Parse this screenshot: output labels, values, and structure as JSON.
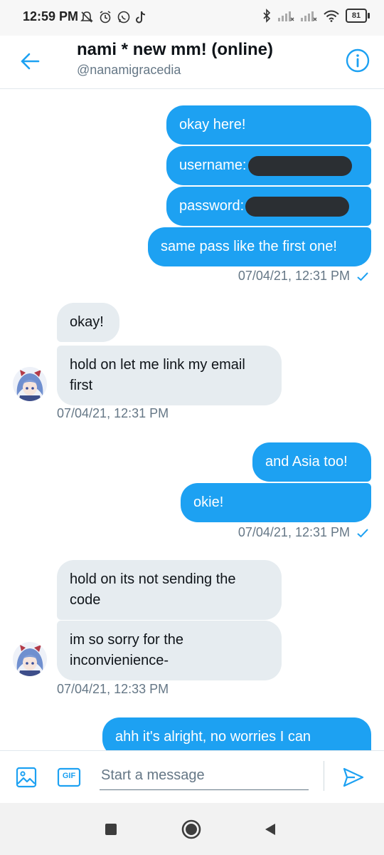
{
  "status_bar": {
    "time": "12:59 PM",
    "battery": "81"
  },
  "header": {
    "title": "nami * new mm! (online)",
    "handle": "@nanamigracedia"
  },
  "messages": {
    "m1": "okay here!",
    "m2_label": "username:",
    "m3_label": "password:",
    "m4": "same pass like the first one!",
    "t1": "07/04/21, 12:31 PM",
    "m5": "okay!",
    "m6_line1": "hold on let me link my email",
    "m6_line2": "first",
    "t2": "07/04/21, 12:31 PM",
    "m7": "and Asia too!",
    "m8": "okie!",
    "t3": "07/04/21, 12:31 PM",
    "m9_line1": "hold on its not sending the",
    "m9_line2": "code",
    "m10_line1": "im so sorry for the",
    "m10_line2": "inconvienience-",
    "t4": "07/04/21, 12:33 PM",
    "m11": "ahh it's alright, no worries I can"
  },
  "composer": {
    "placeholder": "Start a message",
    "gif_label": "GIF"
  },
  "colors": {
    "accent": "#1da1f2",
    "incoming": "#e6ecf0",
    "meta": "#657786"
  }
}
